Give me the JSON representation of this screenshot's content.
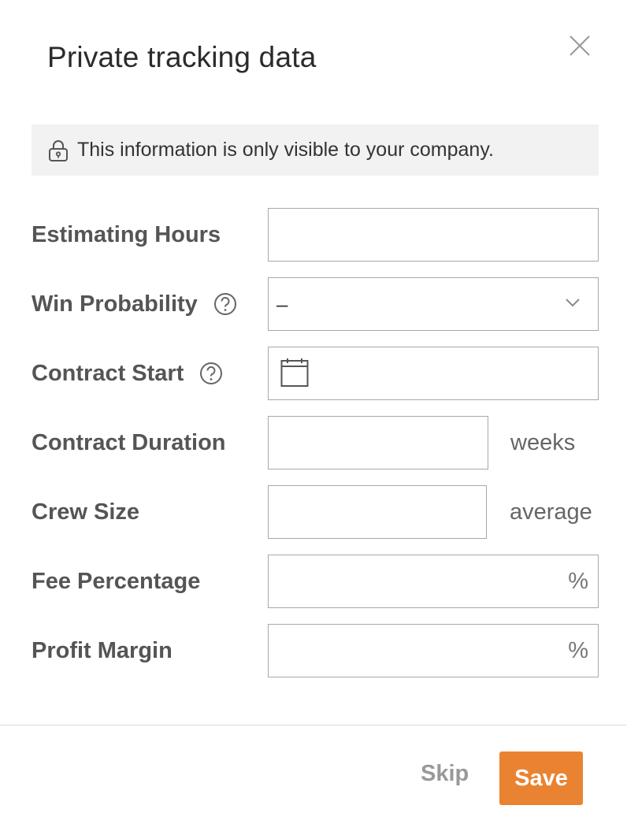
{
  "dialog": {
    "title": "Private tracking data",
    "close_icon": "close-icon",
    "notice": {
      "icon": "lock-icon",
      "text": "This information is only visible to your company."
    }
  },
  "fields": {
    "estimating_hours": {
      "label": "Estimating Hours",
      "value": ""
    },
    "win_probability": {
      "label": "Win Probability",
      "value": "–",
      "icon": "chevron-down-icon",
      "help_icon": "help-icon"
    },
    "contract_start": {
      "label": "Contract Start",
      "value": "",
      "icon": "calendar-icon",
      "help_icon": "help-icon"
    },
    "contract_duration": {
      "label": "Contract Duration",
      "value": "",
      "unit": "weeks"
    },
    "crew_size": {
      "label": "Crew Size",
      "value": "",
      "unit": "average"
    },
    "fee_percentage": {
      "label": "Fee Percentage",
      "value": "",
      "suffix": "%"
    },
    "profit_margin": {
      "label": "Profit Margin",
      "value": "",
      "suffix": "%"
    }
  },
  "footer": {
    "skip_label": "Skip",
    "save_label": "Save"
  },
  "colors": {
    "accent": "#ea8331",
    "notice_bg": "#f2f2f2",
    "border": "#a8a8a8"
  }
}
